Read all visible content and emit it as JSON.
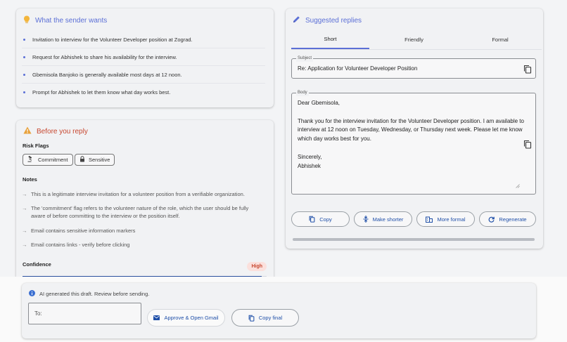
{
  "sender_wants": {
    "title": "What the sender wants",
    "items": [
      "Invitation to interview for the Volunteer Developer position at Zograd.",
      "Request for Abhishek to share his availability for the interview.",
      "Gbemisola Banjoko is generally available most days at 12 noon.",
      "Prompt for Abhishek to let them know what day works best."
    ]
  },
  "before_reply": {
    "title": "Before you reply",
    "risk_flags_label": "Risk Flags",
    "flags": [
      "Commitment",
      "Sensitive"
    ],
    "notes_label": "Notes",
    "notes": [
      "This is a legitimate interview invitation for a volunteer position from a verifiable organization.",
      "The 'commitment' flag refers to the volunteer nature of the role, which the user should be fully aware of before committing to the interview or the position itself.",
      "Email contains sensitive information markers",
      "Email contains links - verify before clicking"
    ],
    "confidence_label": "Confidence",
    "confidence_value": "High",
    "confidence_level": 0.98
  },
  "suggested": {
    "title": "Suggested replies",
    "tabs": [
      "Short",
      "Friendly",
      "Formal"
    ],
    "active_tab": "Short",
    "subject_label": "Subject",
    "subject": "Re: Application for Volunteer Developer Position",
    "body_label": "Body",
    "body": "Dear Gbemisola,\n\nThank you for the interview invitation for the Volunteer Developer position. I am available to interview at 12 noon on Tuesday, Wednesday, or Thursday next week. Please let me know which day works best for you.\n\nSincerely,\nAbhishek",
    "actions": [
      "Copy",
      "Make shorter",
      "More formal",
      "Regenerate"
    ]
  },
  "footer": {
    "notice": "AI generated this draft. Review before sending.",
    "to_placeholder": "To:",
    "approve_label": "Approve & Open Gmail",
    "copy_final_label": "Copy final"
  },
  "colors": {
    "accent": "#5b6fd6",
    "warning": "#c7472f",
    "link": "#1f4fa8",
    "progress": "#2a4f9e",
    "high_badge_bg": "#fbe0dc"
  }
}
